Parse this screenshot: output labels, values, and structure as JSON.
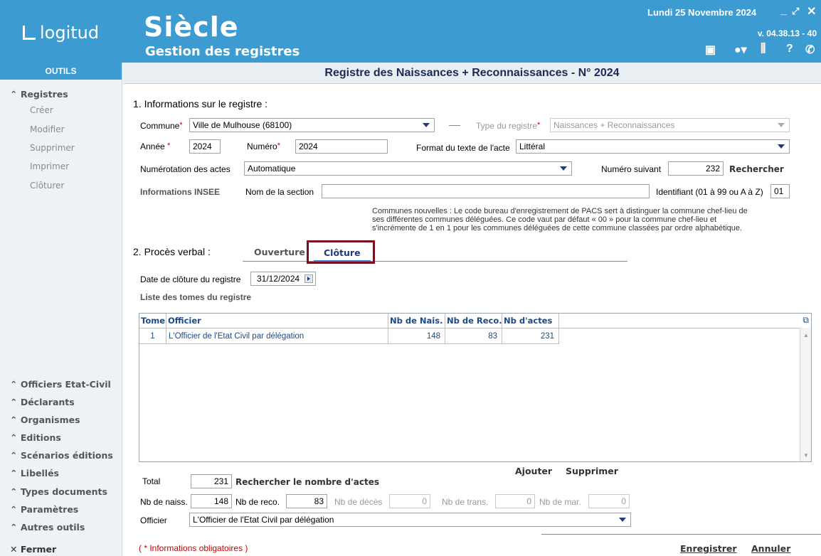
{
  "header": {
    "logo": "logitud",
    "app_title": "Siècle",
    "app_subtitle": "Gestion des registres",
    "date": "Lundi 25 Novembre 2024",
    "version": "v. 04.38.13 - 40"
  },
  "sidebar": {
    "heading": "OUTILS",
    "registres": "Registres",
    "items": [
      "Créer",
      "Modifier",
      "Supprimer",
      "Imprimer",
      "Clôturer"
    ],
    "sections": [
      "Officiers Etat-Civil",
      "Déclarants",
      "Organismes",
      "Editions",
      "Scénarios éditions",
      "Libellés",
      "Types documents",
      "Paramètres",
      "Autres outils"
    ],
    "close": "Fermer"
  },
  "main": {
    "page_title": "Registre des Naissances + Reconnaissances - N° 2024",
    "section1_title": "1. Informations sur le registre :",
    "commune_label": "Commune",
    "commune_value": "Ville de Mulhouse (68100)",
    "type_label": "Type du registre",
    "type_value": "Naissances + Reconnaissances",
    "annee_label": "Année",
    "annee_value": "2024",
    "numero_label": "Numéro",
    "numero_value": "2024",
    "format_label": "Format du texte de l'acte",
    "format_value": "Littéral",
    "numerotation_label": "Numérotation des actes",
    "numerotation_value": "Automatique",
    "numero_suivant_label": "Numéro suivant",
    "numero_suivant_value": "232",
    "rechercher": "Rechercher",
    "insee_label": "Informations INSEE",
    "section_label": "Nom de la section",
    "section_value": "",
    "identifiant_label": "Identifiant (01 à 99 ou A à Z)",
    "identifiant_value": "01",
    "note_line1": "Communes nouvelles : Le code bureau d'enregistrement de PACS sert à distinguer la commune chef-lieu de",
    "note_line2": "ses différentes communes déléguées. Ce code vaut par défaut « 00 » pour la commune chef-lieu et",
    "note_line3": "s'incrémente de 1 en 1 pour les communes déléguées de cette commune classées par ordre alphabétique.",
    "section2_title": "2. Procès verbal :",
    "tab_ouverture": "Ouverture",
    "tab_cloture": "Clôture",
    "date_cloture_label": "Date de clôture du registre",
    "date_cloture_value": "31/12/2024",
    "liste_tomes_label": "Liste des tomes du registre",
    "table": {
      "headers": [
        "Tome",
        "Officier",
        "Nb de Nais.",
        "Nb de Reco.",
        "Nb d'actes"
      ],
      "rows": [
        [
          "1",
          "L'Officier de l'Etat Civil par délégation",
          "148",
          "83",
          "231"
        ]
      ]
    },
    "ajouter": "Ajouter",
    "supprimer": "Supprimer",
    "total_label": "Total",
    "total_value": "231",
    "rechercher_nombre": "Rechercher le nombre d'actes",
    "nb_naiss_label": "Nb de naiss.",
    "nb_naiss_value": "148",
    "nb_reco_label": "Nb de reco.",
    "nb_reco_value": "83",
    "nb_deces_label": "Nb de décès",
    "nb_deces_value": "0",
    "nb_trans_label": "Nb de trans.",
    "nb_trans_value": "0",
    "nb_mar_label": "Nb de mar.",
    "nb_mar_value": "0",
    "officier_label": "Officier",
    "officier_value": "L'Officier de l'Etat Civil par délégation",
    "obligatoires": "( * Informations obligatoires )",
    "enregistrer": "Enregistrer",
    "annuler": "Annuler"
  }
}
